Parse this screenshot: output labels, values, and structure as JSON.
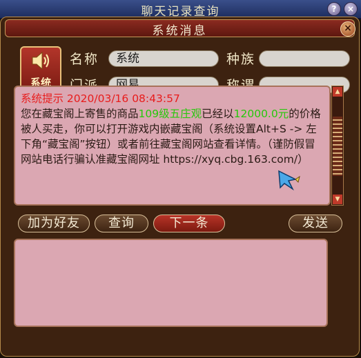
{
  "background_window": {
    "title": "聊天记录查询",
    "help_label": "?",
    "close_label": "×"
  },
  "dialog": {
    "title": "系统消息",
    "close_label": "×",
    "avatar": {
      "label": "系统",
      "icon": "speaker-icon"
    },
    "fields": {
      "name": {
        "label": "名称",
        "value": "系统"
      },
      "race": {
        "label": "种族",
        "value": ""
      },
      "school": {
        "label": "门派",
        "value": "网易"
      },
      "title": {
        "label": "称谓",
        "value": ""
      }
    },
    "message": {
      "header": "系统提示 2020/03/16 08:43:57",
      "part1": "您在藏宝阁上寄售的商品",
      "item": "109级五庄观",
      "part2": "已经以",
      "price": "12000.0元",
      "part3": "的价格被人买走，你可以打开游戏内嵌藏宝阁（系统设置Alt+S -> 左下角“藏宝阁”按钮）或者前往藏宝阁网站查看详情。（谨防假冒网站电话行骗认准藏宝阁网址 https://xyq.cbg.163.com/）"
    },
    "buttons": {
      "add_friend": "加为好友",
      "query": "查询",
      "next": "下一条",
      "send": "发送"
    },
    "input": {
      "value": ""
    },
    "colors": {
      "header_red": "#e81c1c",
      "highlight_green": "#27c80c",
      "panel_pink": "#dba7b2"
    }
  }
}
